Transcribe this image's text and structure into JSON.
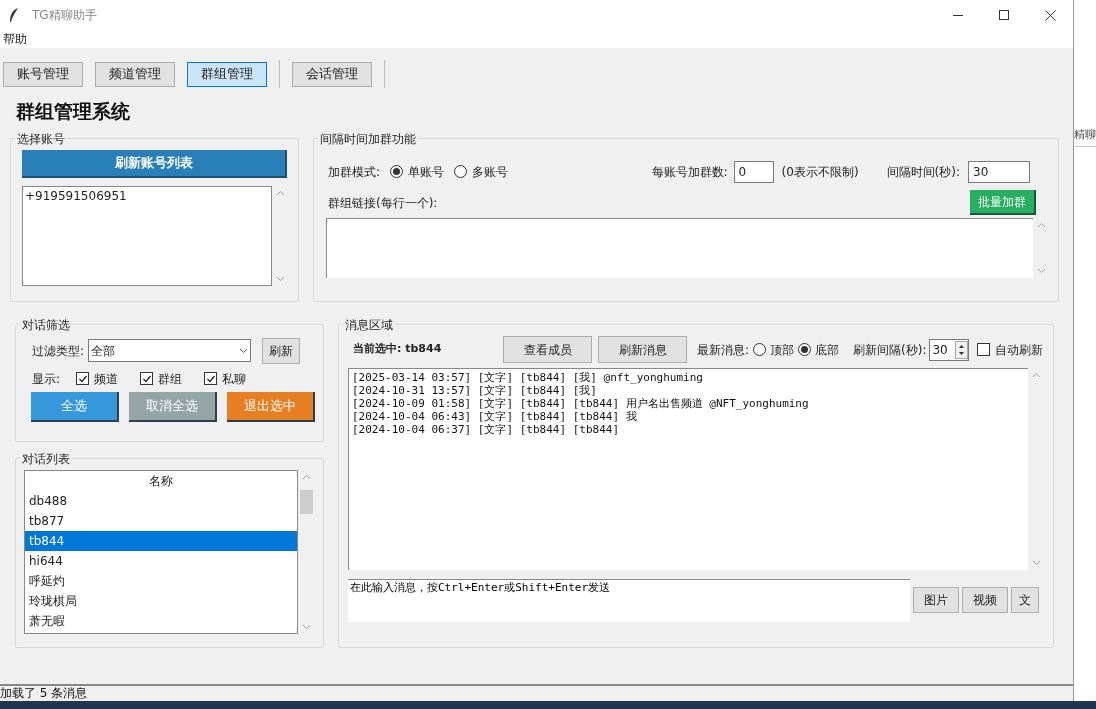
{
  "window": {
    "title": "TG精聊助手"
  },
  "menu": [
    "帮助"
  ],
  "tabs": [
    {
      "label": "账号管理",
      "selected": false
    },
    {
      "label": "频道管理",
      "selected": false
    },
    {
      "label": "群组管理",
      "selected": true
    },
    {
      "label": "会话管理",
      "selected": false
    }
  ],
  "heading": "群组管理系统",
  "account_group": {
    "title": "选择账号",
    "refresh_button": "刷新账号列表",
    "accounts": [
      "+919591506951"
    ]
  },
  "join_group": {
    "title": "间隔时间加群功能",
    "mode_label": "加群模式:",
    "modes": [
      {
        "label": "单账号",
        "selected": true
      },
      {
        "label": "多账号",
        "selected": false
      }
    ],
    "per_account_label": "每账号加群数:",
    "per_account_value": "0",
    "per_account_hint": "(0表示不限制)",
    "interval_label": "间隔时间(秒):",
    "interval_value": "30",
    "links_label": "群组链接(每行一个):",
    "batch_button": "批量加群"
  },
  "filter_group": {
    "title": "对话筛选",
    "type_label": "过滤类型:",
    "type_value": "全部",
    "refresh_button": "刷新",
    "show_label": "显示:",
    "show_options": [
      {
        "label": "频道",
        "checked": true
      },
      {
        "label": "群组",
        "checked": true
      },
      {
        "label": "私聊",
        "checked": true
      }
    ],
    "buttons": [
      {
        "label": "全选",
        "color": "#3498db"
      },
      {
        "label": "取消全选",
        "color": "#95a5a6"
      },
      {
        "label": "退出选中",
        "color": "#e67e22"
      }
    ]
  },
  "conversation_list": {
    "title": "对话列表",
    "column": "名称",
    "rows": [
      {
        "name": "db488",
        "selected": false
      },
      {
        "name": "tb877",
        "selected": false
      },
      {
        "name": "tb844",
        "selected": true
      },
      {
        "name": "hi644",
        "selected": false
      },
      {
        "name": "呼延灼",
        "selected": false
      },
      {
        "name": "玲珑棋局",
        "selected": false
      },
      {
        "name": "萧无暇",
        "selected": false
      }
    ]
  },
  "message_area": {
    "title": "消息区域",
    "current": "当前选中: tb844",
    "buttons": [
      "查看成员",
      "刷新消息"
    ],
    "latest_label": "最新消息:",
    "latest_options": [
      {
        "label": "顶部",
        "selected": false
      },
      {
        "label": "底部",
        "selected": true
      }
    ],
    "interval_label": "刷新间隔(秒):",
    "interval_value": "30",
    "auto_refresh": {
      "label": "自动刷新",
      "checked": false
    },
    "messages": [
      "[2025-03-14 03:57] [文字] [tb844] [我] @nft_yonghuming",
      "[2024-10-31 13:57] [文字] [tb844] [我]",
      "[2024-10-09 01:58] [文字] [tb844] [tb844] 用户名出售频道 @NFT_yonghuming",
      "[2024-10-04 06:43] [文字] [tb844] [tb844] 我",
      "[2024-10-04 06:37] [文字] [tb844] [tb844]"
    ],
    "input_value": "在此输入消息，按Ctrl+Enter或Shift+Enter发送",
    "send_buttons": [
      "图片",
      "视频",
      "文"
    ]
  },
  "status_bar": "加载了 5 条消息",
  "background_window": {
    "text": "精聊"
  }
}
